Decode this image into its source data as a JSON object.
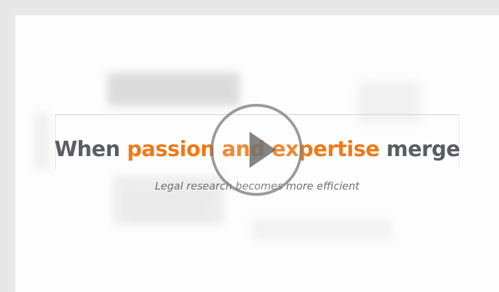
{
  "video": {
    "headline_part1": "When ",
    "headline_accent": "passion and expertise",
    "headline_part2": " merge",
    "subheadline": "Legal research becomes more efficient",
    "play_icon": "play-icon"
  },
  "colors": {
    "accent": "#ee7a18",
    "headline_gray": "#5a5e63",
    "background": "#fdfdfd",
    "frame": "#e9e9e9"
  }
}
